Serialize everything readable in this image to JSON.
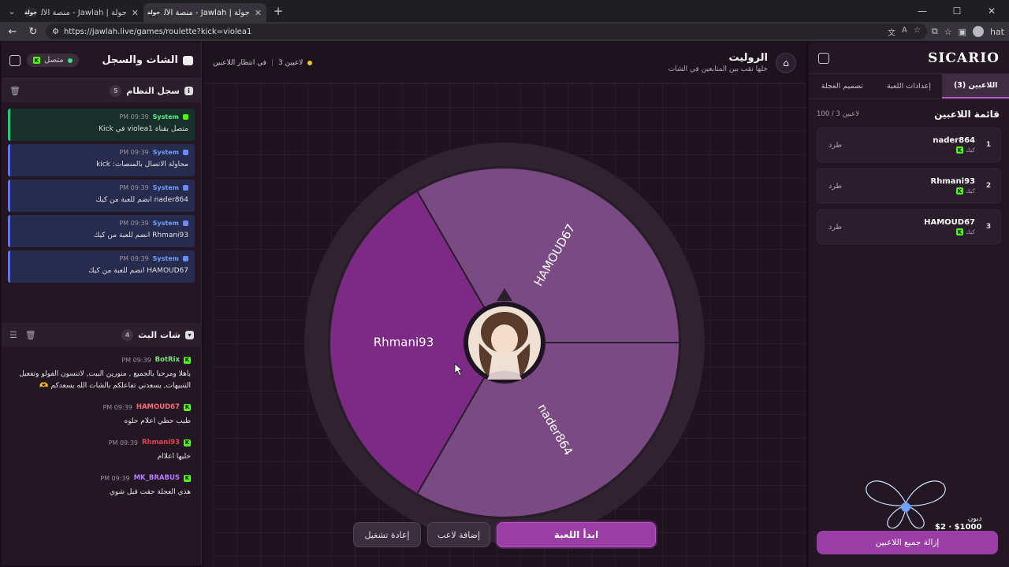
{
  "browser": {
    "tabs": [
      {
        "title": "جولة | Jawlah - منصة الألعاب التفا",
        "active": false
      },
      {
        "title": "جولة | Jawlah - منصة الألعاب التفا",
        "active": true
      }
    ],
    "url": "https://jawlah.live/games/roulette?kick=violea1",
    "tab_favicon": "جولة",
    "profile_label": "hat"
  },
  "left_panel": {
    "title": "الشات والسجل",
    "status": "متصل",
    "system_log": {
      "title": "سجل النظام",
      "count": "5",
      "entries": [
        {
          "who": "System",
          "time": "09:39 PM",
          "text": "متصل بقناة violea1 في Kick",
          "style": "green"
        },
        {
          "who": "System",
          "time": "09:39 PM",
          "text": "محاولة الاتصال بالمنصات: kick",
          "style": "blue"
        },
        {
          "who": "System",
          "time": "09:39 PM",
          "text": "nader864 انضم للعبة من كيك",
          "style": "blue"
        },
        {
          "who": "System",
          "time": "09:39 PM",
          "text": "Rhmani93 انضم للعبة من كيك",
          "style": "blue"
        },
        {
          "who": "System",
          "time": "09:39 PM",
          "text": "HAMOUD67 انضم للعبة من كيك",
          "style": "blue"
        }
      ]
    },
    "chat": {
      "title": "شات البث",
      "count": "4",
      "messages": [
        {
          "nick": "BotRix",
          "color": "#7ee07e",
          "time": "09:39 PM",
          "text": "ياهلا ومرحبا بالجميع , منورين البيت, لاتنسون الفولو وتفعيل التنبيهات, يسعدني تفاعلكم بالشات الله يسعدكم 🫶"
        },
        {
          "nick": "HAMOUD67",
          "color": "#ff6b7a",
          "time": "09:39 PM",
          "text": "طيب حطي اعلام حلوه"
        },
        {
          "nick": "Rhmani93",
          "color": "#e0454f",
          "time": "09:39 PM",
          "text": "خليها اعلاام"
        },
        {
          "nick": "MK_BRABUS",
          "color": "#b77cff",
          "time": "09:39 PM",
          "text": "هذي العجلة حقت قبل شوي"
        }
      ]
    }
  },
  "center": {
    "title": "الروليت",
    "subtitle": "خلها تقب بين المتابعين في الشات",
    "players_count": "3 لاعبين",
    "waiting": "في انتظار اللاعبين",
    "wheel_segments": [
      {
        "name": "HAMOUD67",
        "color": "#7a4a82"
      },
      {
        "name": "nader864",
        "color": "#7a4a82"
      },
      {
        "name": "Rhmani93",
        "color": "#7c2a84"
      }
    ],
    "buttons": {
      "restart": "إعادة تشغيل",
      "add_player": "إضافة لاعب",
      "start": "ابدأ اللعبة"
    }
  },
  "right_panel": {
    "logo": "SICARIO",
    "tabs": [
      "اللاعبين (3)",
      "إعدادات اللعبة",
      "تصميم العجلة"
    ],
    "list_title": "قائمة اللاعبين",
    "list_count": "100 / 3 لاعبين",
    "kick_label": "طرد",
    "platform_label": "كيك",
    "players": [
      {
        "index": "1",
        "name": "nader864"
      },
      {
        "index": "2",
        "name": "Rhmani93"
      },
      {
        "index": "3",
        "name": "HAMOUD67"
      }
    ],
    "remove_all": "إزالة جميع اللاعبين",
    "donation": {
      "name": "ديون",
      "amount": "$2 · $1000"
    }
  },
  "colors": {
    "accent": "#9a3ea6",
    "kick": "#53fc18"
  }
}
